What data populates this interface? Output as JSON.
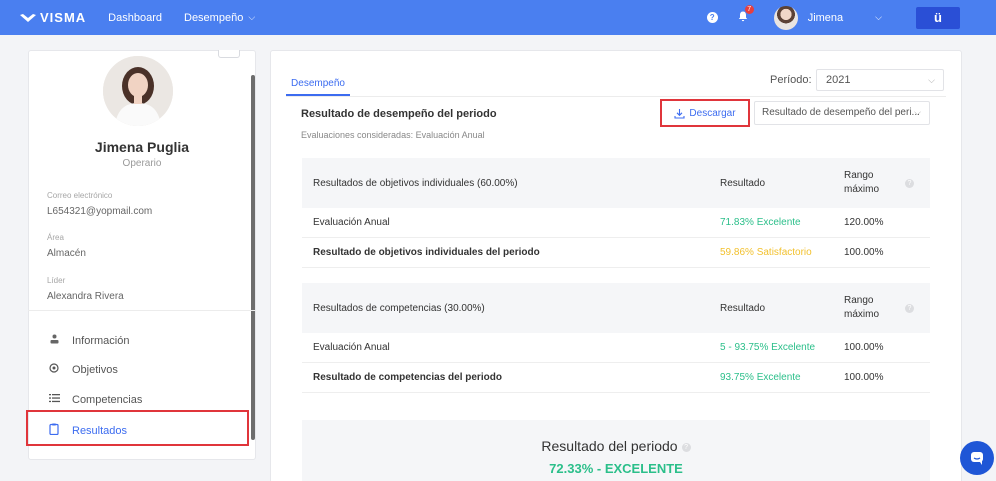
{
  "topbar": {
    "logo": "VISMA",
    "nav": [
      {
        "label": "Dashboard"
      },
      {
        "label": "Desempeño"
      }
    ],
    "notifications_count": "7",
    "user_name": "Jimena",
    "app_button": "ü",
    "accent": "#4a7ff0"
  },
  "sidebar": {
    "name": "Jimena Puglia",
    "role": "Operario",
    "fields": [
      {
        "label": "Correo electrónico",
        "value": "L654321@yopmail.com"
      },
      {
        "label": "Área",
        "value": "Almacén"
      },
      {
        "label": "Líder",
        "value": "Alexandra Rivera"
      }
    ],
    "menu": [
      {
        "label": "Información",
        "icon": "user-icon"
      },
      {
        "label": "Objetivos",
        "icon": "target-icon"
      },
      {
        "label": "Competencias",
        "icon": "list-icon"
      },
      {
        "label": "Resultados",
        "icon": "clipboard-icon",
        "active": true
      }
    ]
  },
  "main": {
    "tab": "Desempeño",
    "periodo_label": "Período:",
    "periodo_value": "2021",
    "section_title": "Resultado de desempeño del periodo",
    "section_subtitle": "Evaluaciones consideradas: Evaluación Anual",
    "download_label": "Descargar",
    "result_select": "Resultado de desempeño del peri...",
    "tables": [
      {
        "header": {
          "col1": "Resultados de objetivos individuales (60.00%)",
          "col2": "Resultado",
          "col3": "Rango máximo"
        },
        "rows": [
          {
            "label": "Evaluación Anual",
            "result": "71.83% Excelente",
            "max": "120.00%",
            "color": "green",
            "bold": false
          },
          {
            "label": "Resultado de objetivos individuales del periodo",
            "result": "59.86% Satisfactorio",
            "max": "100.00%",
            "color": "yellow",
            "bold": true
          }
        ]
      },
      {
        "header": {
          "col1": "Resultados de competencias (30.00%)",
          "col2": "Resultado",
          "col3": "Rango máximo"
        },
        "rows": [
          {
            "label": "Evaluación Anual",
            "result": "5 - 93.75% Excelente",
            "max": "100.00%",
            "color": "green",
            "bold": false
          },
          {
            "label": "Resultado de competencias del periodo",
            "result": "93.75% Excelente",
            "max": "100.00%",
            "color": "green",
            "bold": true
          }
        ]
      }
    ],
    "summary_title": "Resultado del periodo",
    "summary_value": "72.33% - EXCELENTE"
  }
}
